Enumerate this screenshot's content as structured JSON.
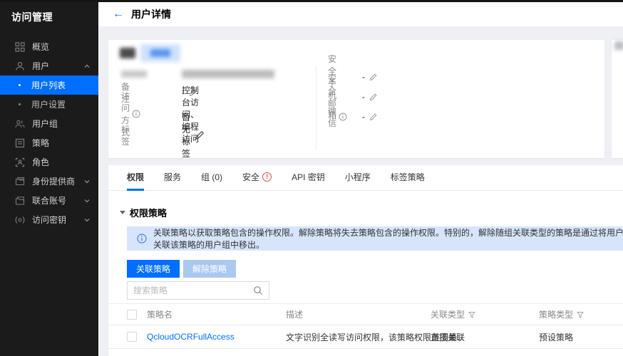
{
  "sidebar": {
    "title": "访问管理",
    "items": [
      {
        "label": "概览",
        "icon": "overview-icon"
      },
      {
        "label": "用户",
        "icon": "user-icon",
        "expanded": true
      },
      {
        "label": "用户列表",
        "sub": true,
        "active": true
      },
      {
        "label": "用户设置",
        "sub": true
      },
      {
        "label": "用户组",
        "icon": "user-group-icon"
      },
      {
        "label": "策略",
        "icon": "policy-icon"
      },
      {
        "label": "角色",
        "icon": "role-icon"
      },
      {
        "label": "身份提供商",
        "icon": "identity-provider-icon",
        "collapsed": true
      },
      {
        "label": "联合账号",
        "icon": "federated-account-icon",
        "collapsed": true
      },
      {
        "label": "访问密钥",
        "icon": "access-key-icon",
        "collapsed": true
      }
    ]
  },
  "header": {
    "back": "←",
    "title": "用户详情"
  },
  "user_card": {
    "fields_left": [
      {
        "label": "备注",
        "value": "-"
      },
      {
        "label": "访问方式",
        "value": "控制台访问、编程访问"
      },
      {
        "label": "标签",
        "value": "暂无标签"
      }
    ],
    "fields_right": [
      {
        "label": "安全手机",
        "value": "-"
      },
      {
        "label": "安全邮箱",
        "value": "-"
      },
      {
        "label": "微信",
        "value": "-"
      }
    ]
  },
  "tabs": [
    {
      "label": "权限",
      "active": true
    },
    {
      "label": "服务"
    },
    {
      "label": "组 (0)"
    },
    {
      "label": "安全",
      "alert": "!"
    },
    {
      "label": "API 密钥"
    },
    {
      "label": "小程序"
    },
    {
      "label": "标签策略"
    }
  ],
  "permission_section": {
    "title": "权限策略",
    "banner": "关联策略以获取策略包含的操作权限。解除策略将失去策略包含的操作权限。特别的，解除随组关联类型的策略是通过将用户从关联该策略的用户组中移出。",
    "buttons": {
      "associate": "关联策略",
      "dissociate": "解除策略"
    },
    "search_placeholder": "搜索策略",
    "table": {
      "columns": [
        "策略名",
        "描述",
        "关联类型",
        "策略类型"
      ],
      "rows": [
        {
          "name": "QcloudOCRFullAccess",
          "desc": "文字识别全读写访问权限，该策略权限范围最...",
          "assoc_type": "直接关联",
          "policy_type": "预设策略"
        }
      ]
    }
  },
  "colors": {
    "accent_blue": "#006eff",
    "sidebar_bg": "#1b1b1b",
    "banner_bg": "#d6e5fb",
    "alert_red": "#e64545",
    "disabled_button": "#abc8f0"
  }
}
